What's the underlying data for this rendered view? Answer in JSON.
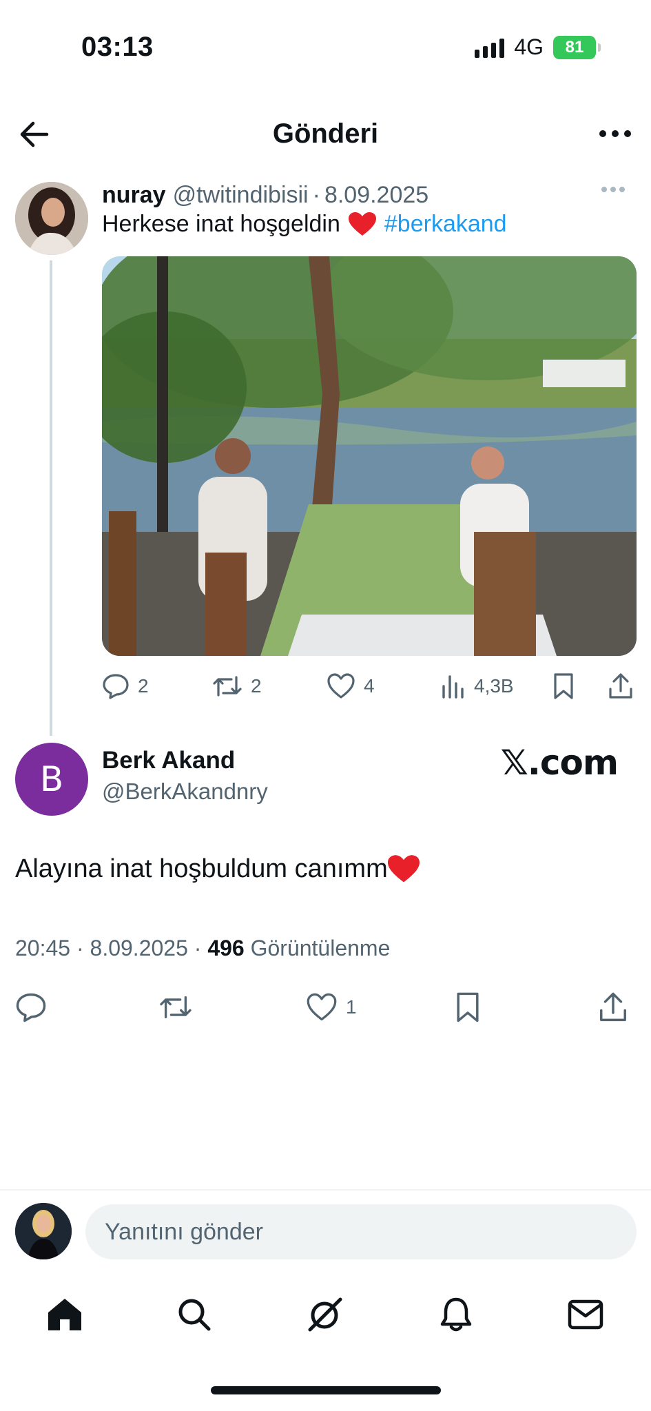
{
  "status_bar": {
    "time": "03:13",
    "network": "4G",
    "battery": "81"
  },
  "header": {
    "title": "Gönderi"
  },
  "quoted_tweet": {
    "name": "nuray",
    "handle": "@twitindibisii",
    "date": "8.09.2025",
    "text_before": "Herkese inat hoşgeldin",
    "hashtag": "#berkakand",
    "stats": {
      "replies": "2",
      "reposts": "2",
      "likes": "4",
      "views": "4,3B"
    }
  },
  "main_tweet": {
    "avatar_letter": "B",
    "avatar_color": "#7b2d9d",
    "name": "Berk Akand",
    "handle": "@BerkAkandnry",
    "watermark": "𝕏.com",
    "text": "Alayına inat hoşbuldum canımm",
    "time": "20:45 · 8.09.2025 ·",
    "views_count": "496",
    "views_label": "Görüntülenme",
    "stats": {
      "likes": "1"
    }
  },
  "reply": {
    "placeholder": "Yanıtını gönder"
  },
  "colors": {
    "accent": "#1d9bf0",
    "heart": "#e0245e",
    "battery": "#34c759"
  },
  "icons": [
    "back-arrow-icon",
    "more-icon",
    "reply-icon",
    "repost-icon",
    "like-icon",
    "views-icon",
    "bookmark-icon",
    "share-icon",
    "home-icon",
    "search-icon",
    "grok-icon",
    "notifications-icon",
    "messages-icon"
  ]
}
